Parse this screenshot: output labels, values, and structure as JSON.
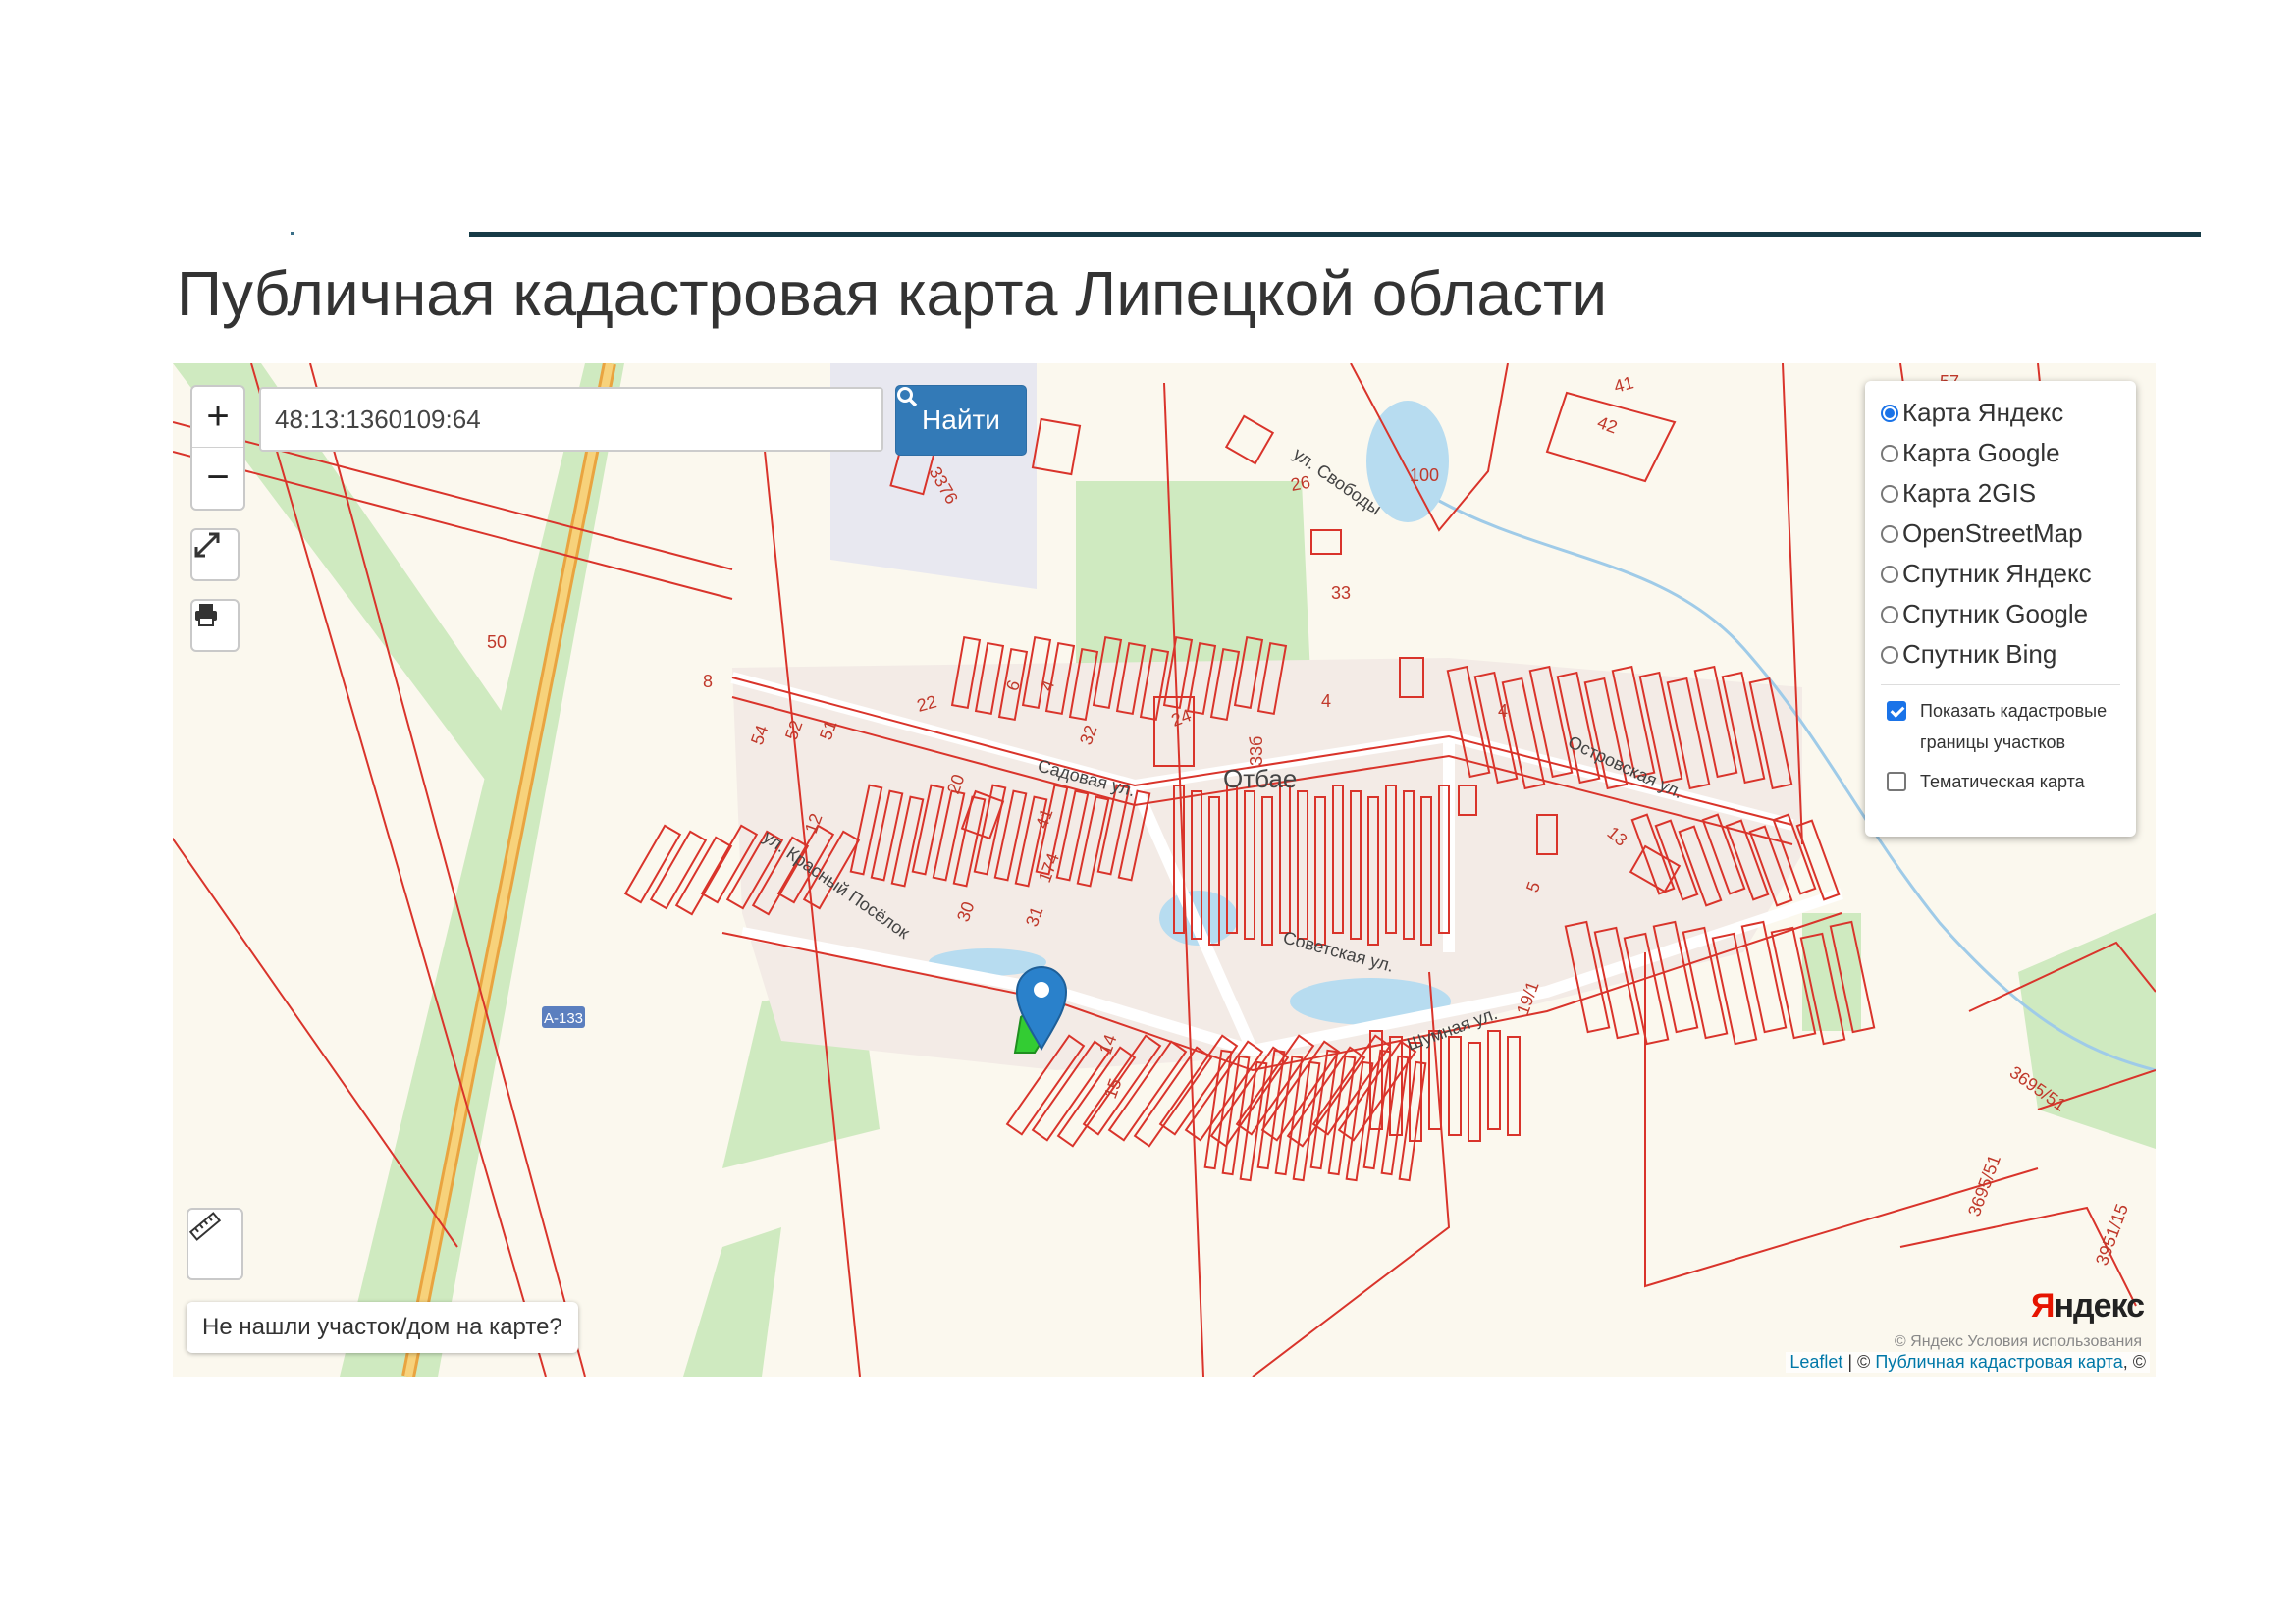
{
  "page": {
    "title": "Публичная кадастровая карта Липецкой области"
  },
  "search": {
    "value": "48:13:1360109:64",
    "button_label": "Найти"
  },
  "zoom": {
    "plus": "+",
    "minus": "−"
  },
  "icons": {
    "fullscreen": "expand-icon",
    "print": "printer-icon",
    "ruler": "ruler-icon",
    "search": "magnifier-icon",
    "marker": "map-marker-icon"
  },
  "layers": {
    "options": [
      {
        "label": "Карта Яндекс",
        "selected": true
      },
      {
        "label": "Карта Google",
        "selected": false
      },
      {
        "label": "Карта 2GIS",
        "selected": false
      },
      {
        "label": "OpenStreetMap",
        "selected": false
      },
      {
        "label": "Спутник Яндекс",
        "selected": false
      },
      {
        "label": "Спутник Google",
        "selected": false
      },
      {
        "label": "Спутник Bing",
        "selected": false
      }
    ],
    "overlays": [
      {
        "label": "Показать кадастровые границы участков",
        "checked": true
      },
      {
        "label": "Тематическая карта",
        "checked": false
      }
    ]
  },
  "not_found_button": "Не нашли участок/дом на карте?",
  "attribution": {
    "leaflet": "Leaflet",
    "separator": " | © ",
    "cadastre": "Публичная кадастровая карта",
    "tail": ", ©",
    "yandex_terms": "© Яндекс  Условия использования"
  },
  "yandex_logo": {
    "first": "Я",
    "rest": "ндекс"
  },
  "map_labels": {
    "parcels": [
      "50",
      "8",
      "3376",
      "26",
      "100",
      "41",
      "42",
      "57",
      "4",
      "33",
      "22",
      "6",
      "4",
      "32",
      "24",
      "4",
      "54",
      "52",
      "51",
      "20",
      "12",
      "41",
      "174",
      "31",
      "30",
      "13",
      "5",
      "14",
      "15",
      "33б",
      "19/1",
      "3695/51",
      "3695/51",
      "3951/15"
    ],
    "road_shield": "А-133",
    "village": "Отбае",
    "streets": [
      "ул. Свободы",
      "Садовая ул.",
      "Островская ул.",
      "ул. Красный Посёлок",
      "Советская ул.",
      "Шумная ул."
    ]
  },
  "colors": {
    "parcel_border": "#d9342b",
    "selected_parcel": "#33cc33",
    "green_area": "#cfeac0",
    "water": "#b7dcf0",
    "map_background": "#fbf8ee",
    "search_button": "#337ab7",
    "marker": "#2a81cb"
  }
}
